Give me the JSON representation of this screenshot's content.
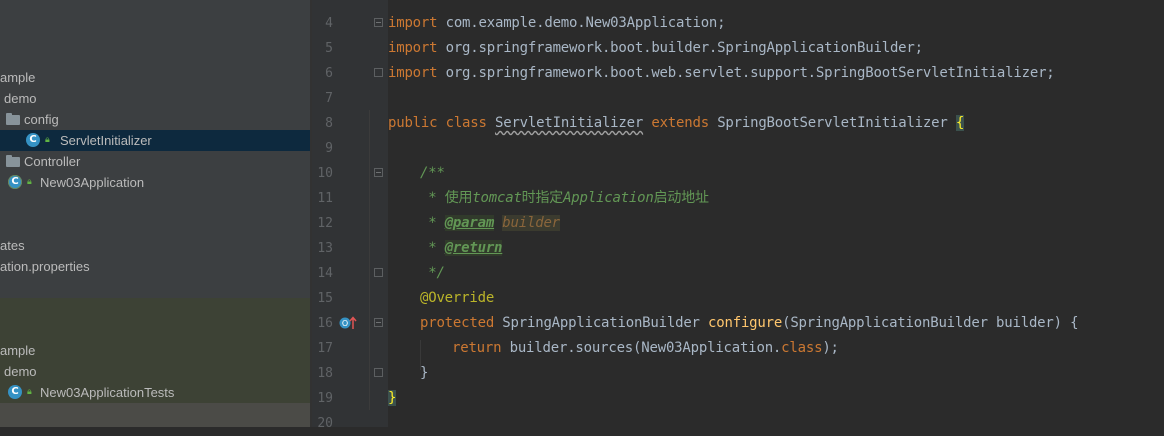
{
  "project_tree": {
    "rows": [
      {
        "label": "ample",
        "kind": "package"
      },
      {
        "label": "demo",
        "kind": "package"
      },
      {
        "label": "config",
        "kind": "folder"
      },
      {
        "label": "ServletInitializer",
        "kind": "class",
        "selected": true
      },
      {
        "label": "Controller",
        "kind": "folder"
      },
      {
        "label": "New03Application",
        "kind": "boot-class"
      },
      {
        "label": "ates",
        "kind": "folder"
      },
      {
        "label": "ation.properties",
        "kind": "file"
      },
      {
        "label": "ample",
        "kind": "package"
      },
      {
        "label": "demo",
        "kind": "package"
      },
      {
        "label": "New03ApplicationTests",
        "kind": "test-class"
      }
    ]
  },
  "editor": {
    "line_numbers": [
      "4",
      "5",
      "6",
      "7",
      "8",
      "9",
      "10",
      "11",
      "12",
      "13",
      "14",
      "15",
      "16",
      "17",
      "18",
      "19",
      "20"
    ],
    "lines": {
      "l4": {
        "kw": "import",
        "text": " com.example.demo.New03Application;"
      },
      "l5": {
        "kw": "import",
        "text": " org.springframework.boot.builder.SpringApplicationBuilder;"
      },
      "l6": {
        "kw": "import",
        "text": " org.springframework.boot.web.servlet.support.SpringBootServletInitializer;"
      },
      "l8": {
        "kw1": "public class",
        "cls": "ServletInitializer",
        "kw2": "extends",
        "parent": "SpringBootServletInitializer",
        "brace": "{"
      },
      "l10": {
        "text": "/**"
      },
      "l11": {
        "star": " * ",
        "text": "使用",
        "em1": "tomcat",
        "text2": "时指定",
        "em2": "Application",
        "text3": "启动地址"
      },
      "l12": {
        "star": " * ",
        "tag": "@param",
        "param": "builder"
      },
      "l13": {
        "star": " * ",
        "tag": "@return"
      },
      "l14": {
        "text": " */"
      },
      "l15": {
        "ann": "@Override"
      },
      "l16": {
        "kw": "protected",
        "type": "SpringApplicationBuilder",
        "fn": "configure",
        "args": "(SpringApplicationBuilder builder) {"
      },
      "l17": {
        "kw": "return",
        "text": " builder.sources(New03Application.",
        "kw2": "class",
        "end": ");"
      },
      "l18": {
        "text": "}"
      },
      "l19": {
        "brace": "}"
      }
    }
  },
  "colors": {
    "background": "#2b2b2b",
    "keyword": "#cc7832",
    "comment": "#629755",
    "annotation": "#bbb529",
    "method": "#ffc66d",
    "selection": "#0d293e"
  }
}
